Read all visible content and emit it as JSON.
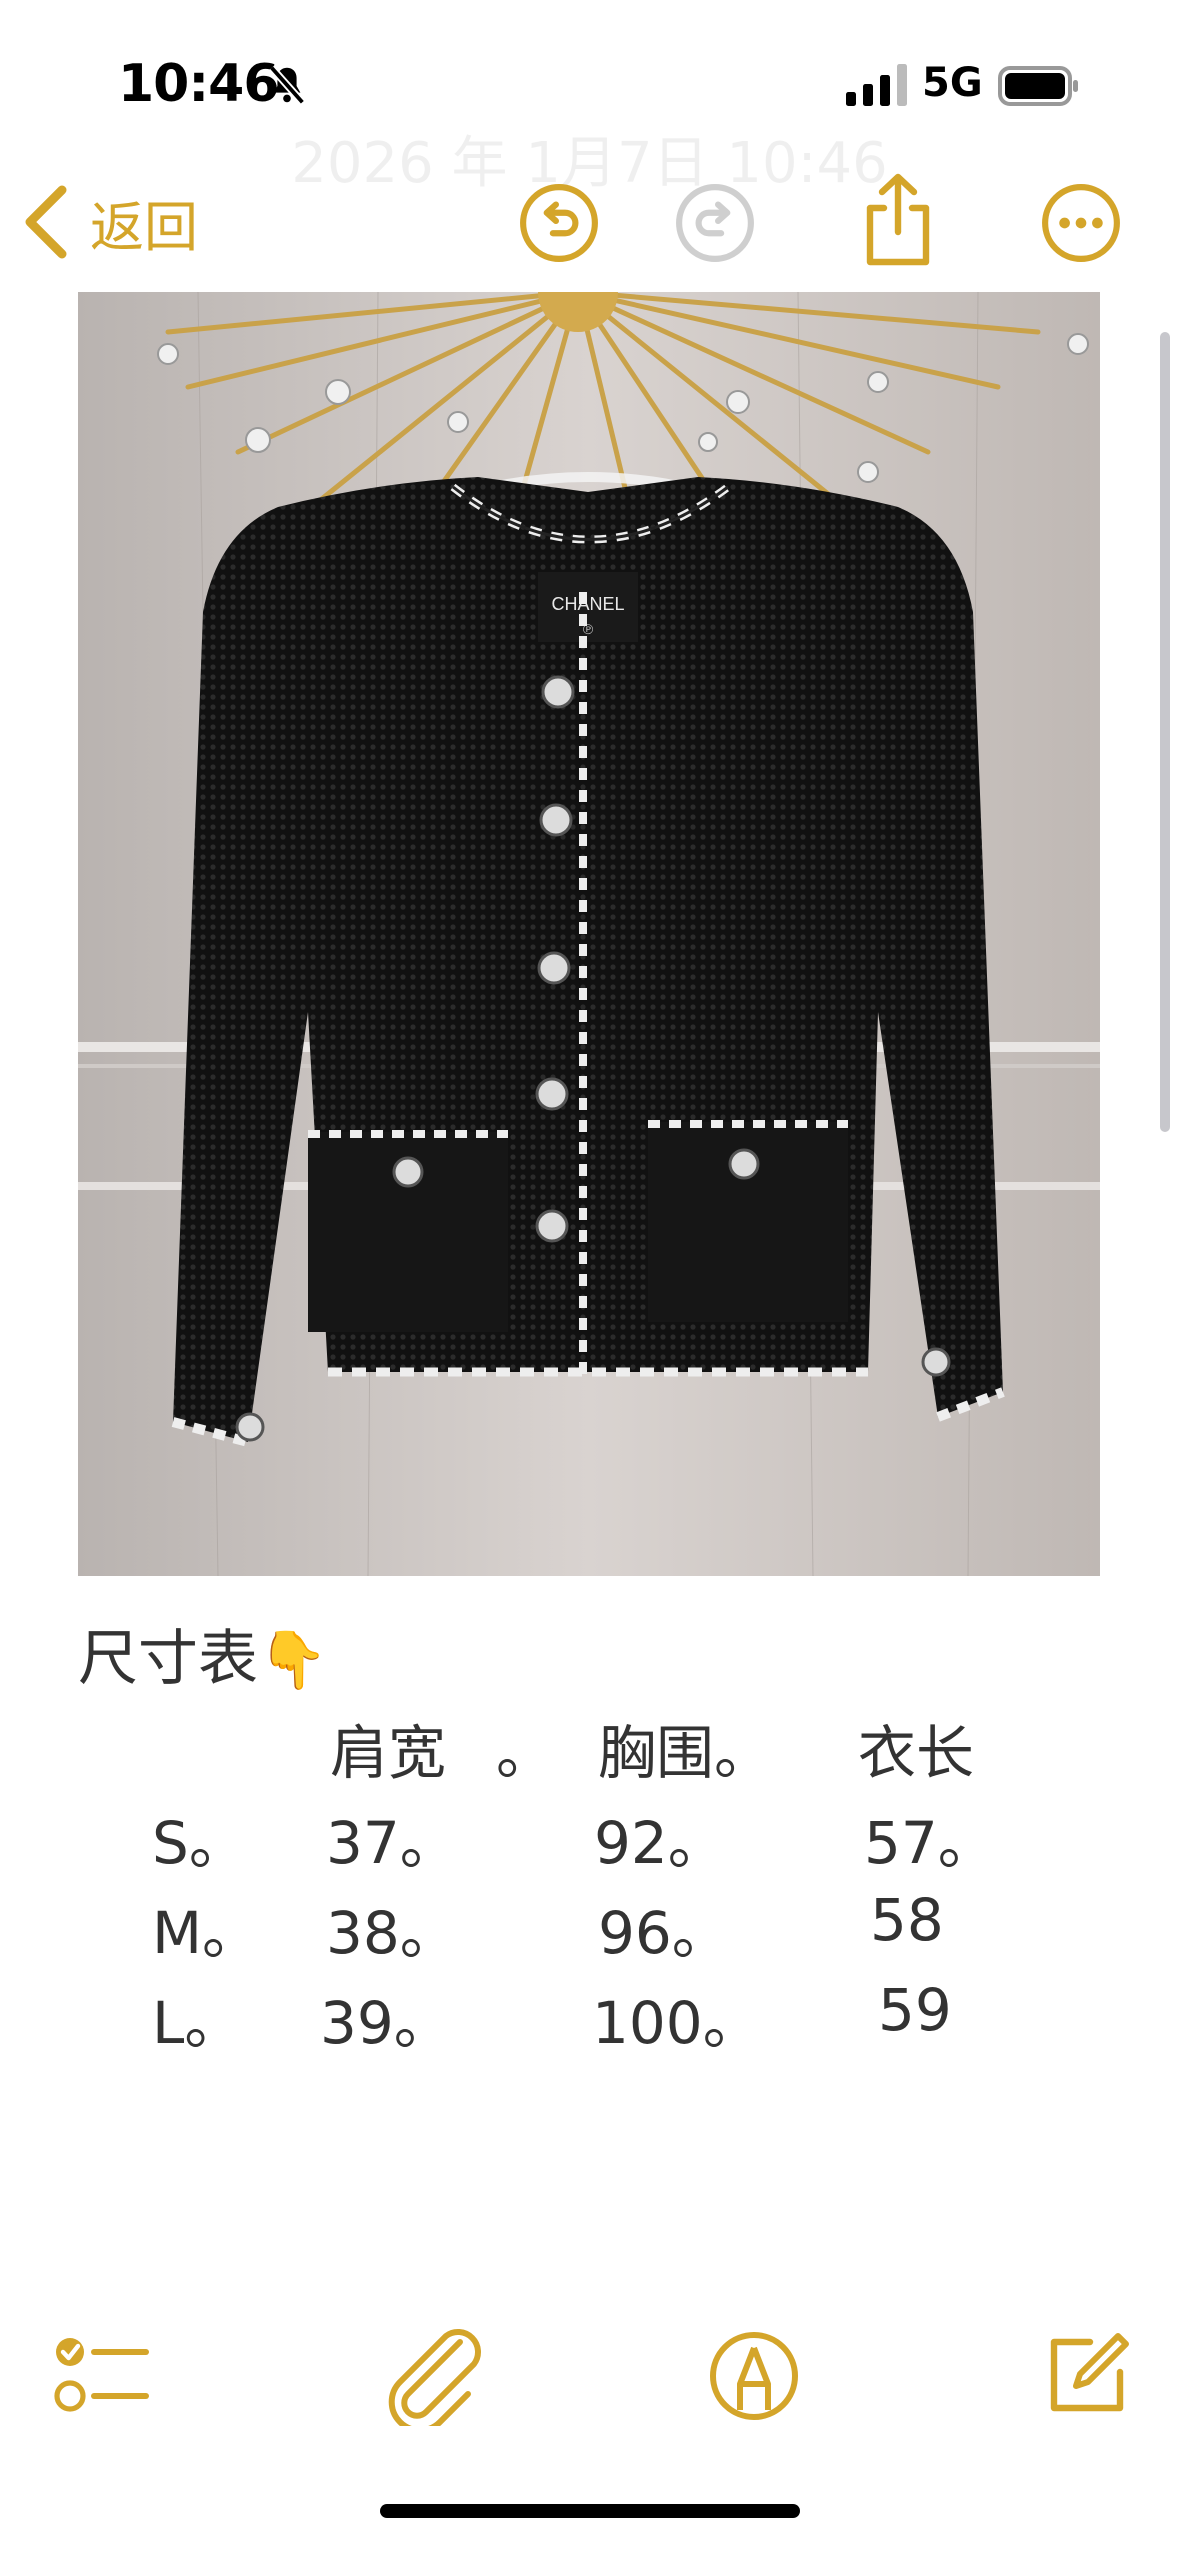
{
  "status_bar": {
    "time": "10:46",
    "network": "5G",
    "silent_icon": "bell-slash-icon",
    "signal_icon": "cellular-signal-icon",
    "battery_icon": "battery-icon"
  },
  "note_date": "2026 年 1月7日 10:46",
  "nav": {
    "back_label": "返回",
    "icons": [
      "chevron-left-icon",
      "undo-icon",
      "redo-icon",
      "share-icon",
      "more-icon"
    ]
  },
  "photo": {
    "garment_label_line1": "CHANEL",
    "garment_label_line2": "℗"
  },
  "note": {
    "title": "尺寸表",
    "title_emoji": "👇",
    "headers": [
      "肩宽",
      "。",
      "胸围。",
      "衣长"
    ],
    "rows": [
      {
        "size": "S。",
        "shoulder": "37。",
        "chest": "92。",
        "length": "57。"
      },
      {
        "size": "M。",
        "shoulder": "38。",
        "chest": "96。",
        "length": "58"
      },
      {
        "size": "L。",
        "shoulder": "39。",
        "chest": "100。",
        "length": "59"
      }
    ]
  },
  "toolbar": {
    "icons": [
      "checklist-icon",
      "paperclip-icon",
      "markup-pen-icon",
      "compose-icon"
    ]
  },
  "colors": {
    "accent": "#D4A52A",
    "text": "#333333",
    "background": "#FFFFFF"
  }
}
